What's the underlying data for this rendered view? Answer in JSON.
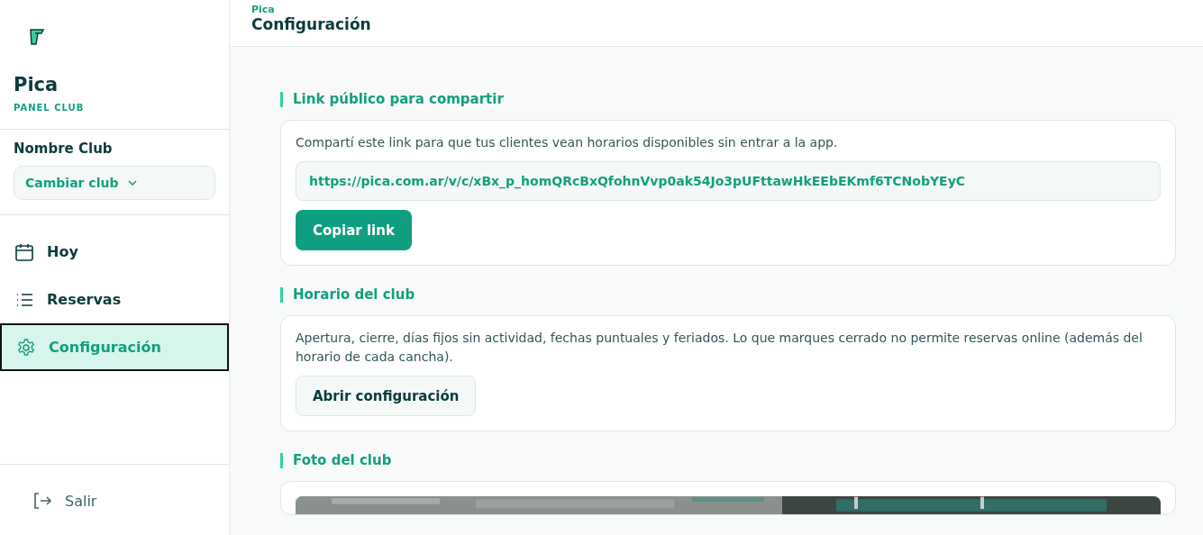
{
  "sidebar": {
    "brand": "Pica",
    "subtitle": "PANEL CLUB",
    "club_name": "Nombre Club",
    "club_switch": "Cambiar club",
    "items": [
      {
        "label": "Hoy",
        "kind": "calendar",
        "selected": false
      },
      {
        "label": "Reservas",
        "kind": "list",
        "selected": false
      },
      {
        "label": "Configuración",
        "kind": "settings",
        "selected": true
      }
    ],
    "logout": "Salir"
  },
  "header": {
    "breadcrumb": "Pica",
    "title": "Configuración"
  },
  "sections": [
    {
      "kind": "link",
      "title": "Link público para compartir",
      "text": "Compartí este link para que tus clientes vean horarios disponibles sin entrar a la app.",
      "url": "https://pica.com.ar/v/c/xBx_p_homQRcBxQfohnVvp0ak54Jo3pUFttawHkEEbEKmf6TCNobYEyC",
      "button": "Copiar link"
    },
    {
      "kind": "action",
      "title": "Horario del club",
      "text": "Apertura, cierre, días fijos sin actividad, fechas puntuales y feriados. Lo que marques cerrado no permite reservas online (además del horario de cada cancha).",
      "button": "Abrir configuración"
    },
    {
      "title": "Foto del club"
    }
  ]
}
